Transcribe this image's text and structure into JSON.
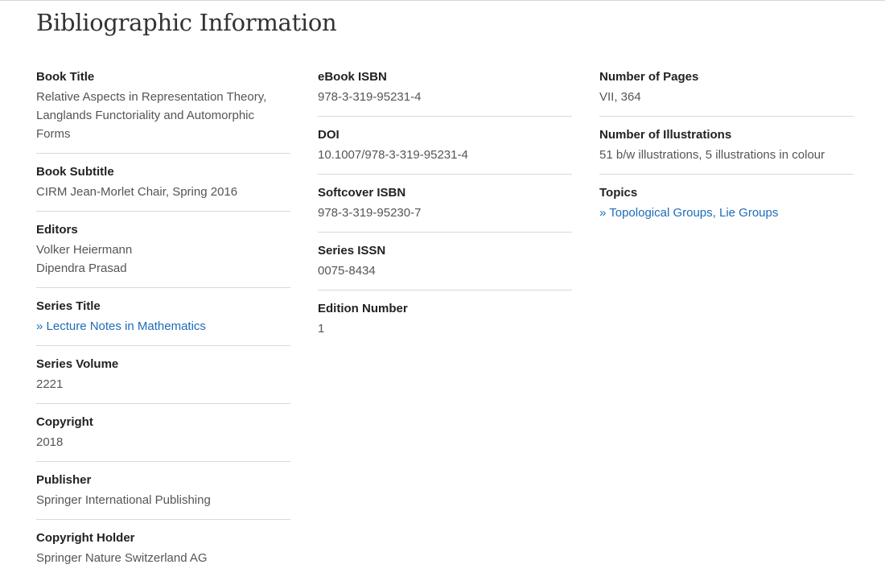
{
  "page": {
    "title": "Bibliographic Information"
  },
  "columns": {
    "left": {
      "book_title": {
        "label": "Book Title",
        "lines": [
          "Relative Aspects in Representation Theory,",
          "Langlands Functoriality and Automorphic",
          "Forms"
        ]
      },
      "book_subtitle": {
        "label": "Book Subtitle",
        "value": "CIRM Jean-Morlet Chair, Spring 2016"
      },
      "editors": {
        "label": "Editors",
        "names": [
          "Volker Heiermann",
          "Dipendra Prasad"
        ]
      },
      "series_title": {
        "label": "Series Title",
        "link_text": "» Lecture Notes in Mathematics"
      },
      "series_volume": {
        "label": "Series Volume",
        "value": "2221"
      },
      "copyright": {
        "label": "Copyright",
        "value": "2018"
      },
      "publisher": {
        "label": "Publisher",
        "value": "Springer International Publishing"
      },
      "copyright_holder": {
        "label": "Copyright Holder",
        "value": "Springer Nature Switzerland AG"
      }
    },
    "middle": {
      "ebook_isbn": {
        "label": "eBook ISBN",
        "value": "978-3-319-95231-4"
      },
      "doi": {
        "label": "DOI",
        "value": "10.1007/978-3-319-95231-4"
      },
      "softcover_isbn": {
        "label": "Softcover ISBN",
        "value": "978-3-319-95230-7"
      },
      "series_issn": {
        "label": "Series ISSN",
        "value": "0075-8434"
      },
      "edition_number": {
        "label": "Edition Number",
        "value": "1"
      }
    },
    "right": {
      "number_of_pages": {
        "label": "Number of Pages",
        "value": "VII, 364"
      },
      "number_of_illustrations": {
        "label": "Number of Illustrations",
        "value": "51 b/w illustrations, 5 illustrations in colour"
      },
      "topics": {
        "label": "Topics",
        "link_text": "» Topological Groups, Lie Groups"
      }
    }
  },
  "colors": {
    "text": "#333333",
    "label": "#222222",
    "value": "#555555",
    "link": "#1e6bb8",
    "divider": "#d9d9d9"
  }
}
